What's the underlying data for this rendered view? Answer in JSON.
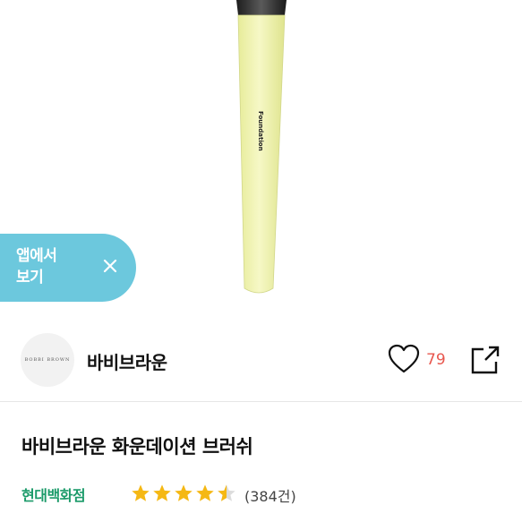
{
  "hero": {
    "brush_label": "Foundation"
  },
  "app_banner": {
    "label_line1": "앱에서",
    "label_line2": "보기"
  },
  "brand": {
    "logo_text": "BOBBI BROWN",
    "name": "바비브라운"
  },
  "actions": {
    "like_count": "79"
  },
  "product": {
    "title": "바비브라운 화운데이션 브러쉬",
    "seller": "현대백화점"
  },
  "rating": {
    "value": 4.5,
    "max": 5,
    "review_count": "(384건)"
  },
  "colors": {
    "accent_teal": "#6cc8dd",
    "seller_green": "#1c9b6a",
    "like_red": "#e8574e",
    "star_gold": "#f5b814"
  }
}
